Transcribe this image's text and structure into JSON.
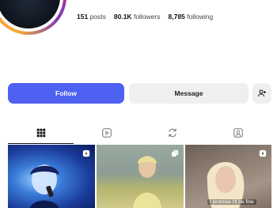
{
  "profile": {
    "stats": {
      "posts_value": "151",
      "posts_label": "posts",
      "followers_value": "80.1K",
      "followers_label": "followers",
      "following_value": "8,785",
      "following_label": "following"
    }
  },
  "actions": {
    "follow_label": "Follow",
    "message_label": "Message"
  },
  "tabs": [
    {
      "icon": "grid-icon",
      "active": true
    },
    {
      "icon": "reels-icon",
      "active": false
    },
    {
      "icon": "reposts-icon",
      "active": false
    },
    {
      "icon": "tagged-icon",
      "active": false
    }
  ],
  "posts": [
    {
      "type": "reel",
      "caption": ""
    },
    {
      "type": "multi",
      "caption": ""
    },
    {
      "type": "reel",
      "caption": "I promise I'll be fine"
    }
  ],
  "colors": {
    "follow_button": "#4e61f3",
    "secondary_button": "#efeff2"
  }
}
